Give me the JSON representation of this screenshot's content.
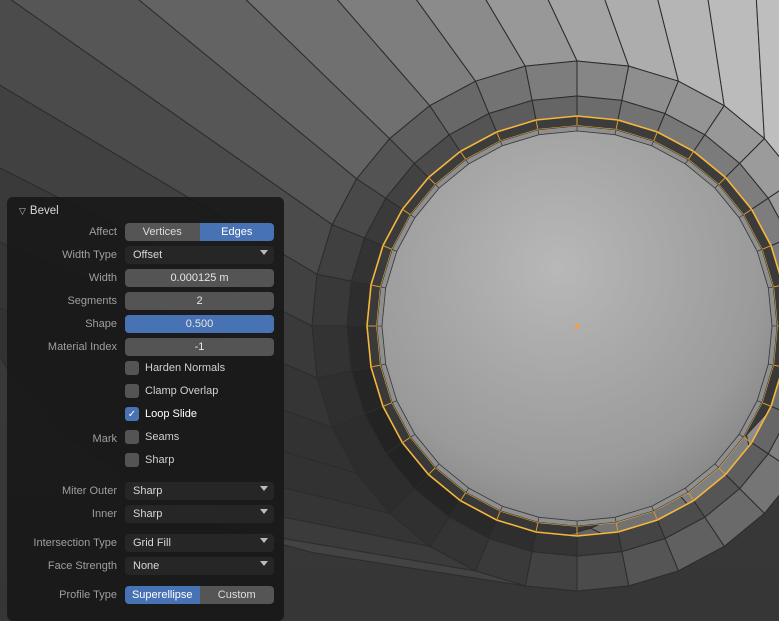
{
  "panel": {
    "title": "Bevel",
    "affect": {
      "label": "Affect",
      "vertices": "Vertices",
      "edges": "Edges",
      "selected": "Edges"
    },
    "width_type": {
      "label": "Width Type",
      "value": "Offset"
    },
    "width": {
      "label": "Width",
      "value": "0.000125 m"
    },
    "segments": {
      "label": "Segments",
      "value": "2"
    },
    "shape": {
      "label": "Shape",
      "value": "0.500",
      "fill_pct": 50
    },
    "material_index": {
      "label": "Material Index",
      "value": "-1"
    },
    "checkboxes": {
      "harden_normals": {
        "label": "Harden Normals",
        "checked": false
      },
      "clamp_overlap": {
        "label": "Clamp Overlap",
        "checked": false
      },
      "loop_slide": {
        "label": "Loop Slide",
        "checked": true
      }
    },
    "mark": {
      "label": "Mark",
      "seams": {
        "label": "Seams",
        "checked": false
      },
      "sharp": {
        "label": "Sharp",
        "checked": false
      }
    },
    "miter_outer": {
      "label": "Miter Outer",
      "value": "Sharp"
    },
    "miter_inner": {
      "label": "Inner",
      "value": "Sharp"
    },
    "intersection_type": {
      "label": "Intersection Type",
      "value": "Grid Fill"
    },
    "face_strength": {
      "label": "Face Strength",
      "value": "None"
    },
    "profile_type": {
      "label": "Profile Type",
      "superellipse": "Superellipse",
      "custom": "Custom",
      "selected": "Superellipse"
    }
  }
}
